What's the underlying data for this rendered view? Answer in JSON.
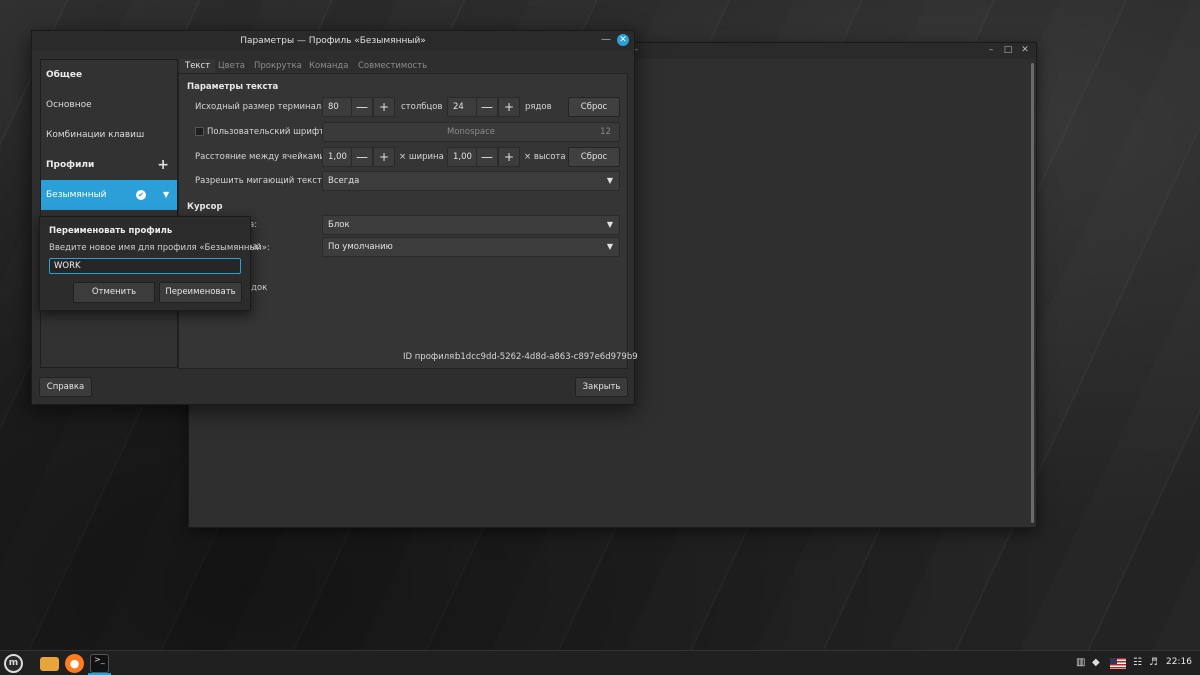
{
  "terminal": {
    "title": "—",
    "controls": {
      "min": "–",
      "max": "□",
      "close": "✕"
    }
  },
  "dialog": {
    "title": "Параметры — Профиль «Безымянный»",
    "min_glyph": "—",
    "close_glyph": "✕",
    "sidebar": {
      "general_header": "Общее",
      "main": "Основное",
      "shortcuts": "Комбинации клавиш",
      "profiles_header": "Профили",
      "add_glyph": "+",
      "selected_profile": "Безымянный",
      "check_glyph": "✔",
      "caret_glyph": "▼"
    },
    "tabs": [
      "Текст",
      "Цвета",
      "Прокрутка",
      "Команда",
      "Совместимость"
    ],
    "text_section": {
      "title": "Параметры текста",
      "size_label": "Исходный размер терминала:",
      "columns_value": "80",
      "columns_unit": "столбцов",
      "rows_value": "24",
      "rows_unit": "рядов",
      "reset": "Сброс",
      "minus": "—",
      "plus": "+",
      "custom_font_label": "Пользовательский шрифт:",
      "font_name": "Monospace",
      "font_size": "12",
      "spacing_label": "Расстояние между ячейками:",
      "width_value": "1,00",
      "width_unit": "× ширина",
      "height_value": "1,00",
      "height_unit": "× высота",
      "blink_label": "Разрешить мигающий текст:",
      "blink_value": "Всегда",
      "caret": "▼"
    },
    "cursor_section": {
      "title": "Курсор",
      "shape_label_partial": "а:",
      "shape_value": "Блок",
      "blink_label_partial": "ра:",
      "blink_value": "По умолчанию",
      "extra_partial": "док"
    },
    "profile_id_label": "ID профиля:",
    "profile_id": "b1dcc9dd-5262-4d8d-a863-c897e6d979b9",
    "help_button": "Справка",
    "close_button": "Закрыть"
  },
  "rename_popover": {
    "title": "Переименовать профиль",
    "description": "Введите новое имя для профиля «Безымянный»:",
    "input_value": "WORK",
    "cancel_button": "Отменить",
    "rename_button": "Переименовать"
  },
  "taskbar": {
    "menu_glyph": "m",
    "firefox_glyph": "●",
    "terminal_glyph": ">_",
    "clock": "22:16",
    "tray_clipboard": "▥",
    "tray_shield": "◆",
    "tray_network": "☷"
  },
  "accent_color": "#2a9fd8"
}
